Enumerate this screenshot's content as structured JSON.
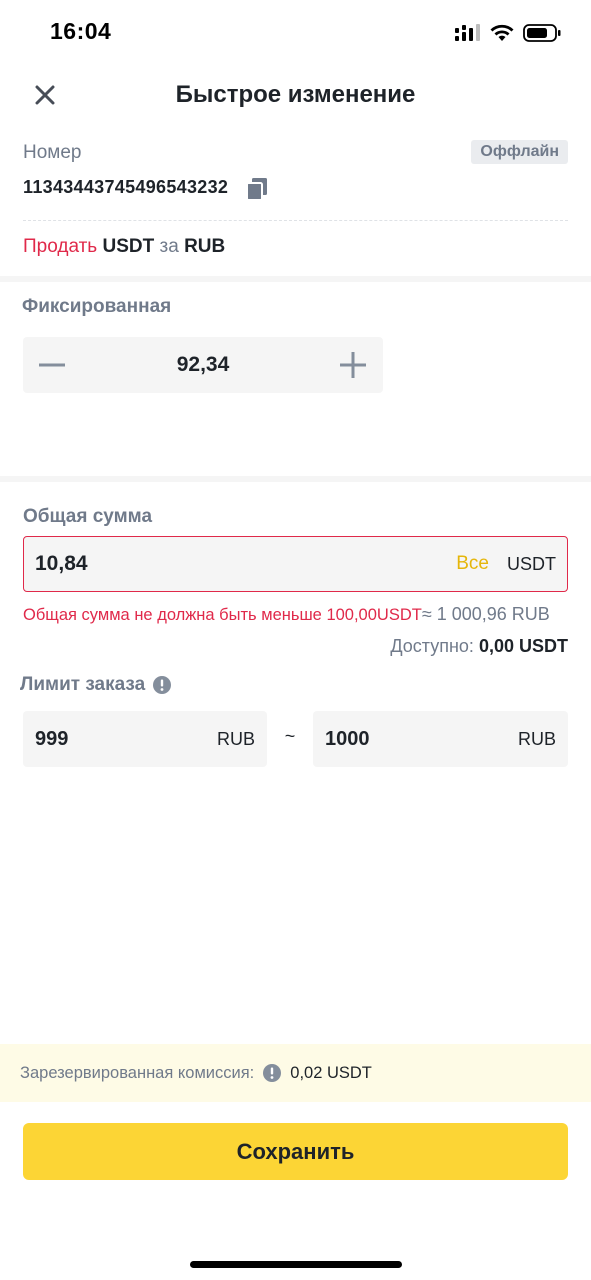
{
  "status_bar": {
    "time": "16:04"
  },
  "header": {
    "title": "Быстрое изменение"
  },
  "order": {
    "number_label": "Номер",
    "status_badge": "Оффлайн",
    "number": "11343443745496543232"
  },
  "trade": {
    "side": "Продать",
    "asset": "USDT",
    "connector": "за",
    "fiat": "RUB"
  },
  "price": {
    "label": "Фиксированная",
    "value": "92,34"
  },
  "total": {
    "label": "Общая сумма",
    "value": "10,84",
    "all_label": "Все",
    "unit": "USDT",
    "error": "Общая сумма не должна быть меньше 100,00USDT",
    "error_equiv": "≈ 1 000,96  RUB",
    "available_label": "Доступно:",
    "available_value": "0,00 USDT"
  },
  "limit": {
    "label": "Лимит заказа",
    "min_value": "999",
    "min_unit": "RUB",
    "separator": "~",
    "max_value": "1000",
    "max_unit": "RUB"
  },
  "fee": {
    "label": "Зарезервированная комиссия:",
    "value": "0,02 USDT"
  },
  "save_button": "Сохранить",
  "colors": {
    "accent": "#fcd535",
    "error": "#e0294a",
    "sell": "#e0294a",
    "all_link": "#e5b60b",
    "fee_bg": "#fefbe6"
  },
  "icons": [
    "cellular-icon",
    "wifi-icon",
    "battery-icon",
    "close-icon",
    "copy-icon",
    "minus-icon",
    "plus-icon",
    "info-icon"
  ]
}
